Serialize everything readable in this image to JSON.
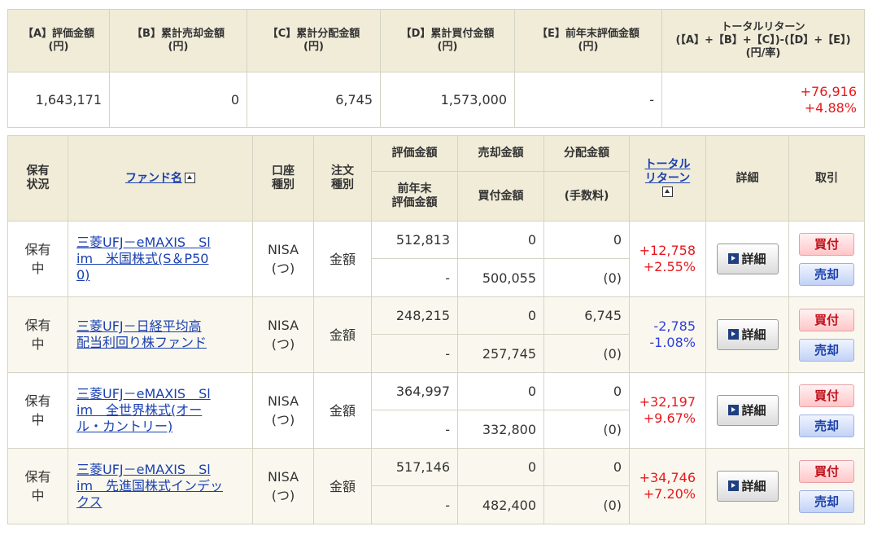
{
  "summary": {
    "headers": [
      [
        "【A】評価金額",
        "(円)"
      ],
      [
        "【B】累計売却金額",
        "(円)"
      ],
      [
        "【C】累計分配金額",
        "(円)"
      ],
      [
        "【D】累計買付金額",
        "(円)"
      ],
      [
        "【E】前年末評価金額",
        "(円)"
      ],
      [
        "トータルリターン",
        "(【A】+【B】+【C】)-(【D】+【E】)",
        "(円/率)"
      ]
    ],
    "values": [
      "1,643,171",
      "0",
      "6,745",
      "1,573,000",
      "-"
    ],
    "total_return_amount": "+76,916",
    "total_return_rate": "+4.88%"
  },
  "table_headers": {
    "status": [
      "保有",
      "状況"
    ],
    "fund_name": "ファンド名",
    "account": [
      "口座",
      "種別"
    ],
    "order": [
      "注文",
      "種別"
    ],
    "valuation": "評価金額",
    "prev_valuation": [
      "前年末",
      "評価金額"
    ],
    "sale": "売却金額",
    "purchase": "買付金額",
    "dividend": "分配金額",
    "fee": "(手数料)",
    "total_return": [
      "トータル",
      "リターン"
    ],
    "detail": "詳細",
    "trade": "取引"
  },
  "buttons": {
    "detail": "詳細",
    "buy": "買付",
    "sell": "売却"
  },
  "holdings": [
    {
      "status": [
        "保有",
        "中"
      ],
      "fund_lines": [
        "三菱UFJ－eMAXIS　Sl",
        "im　米国株式(S＆P50",
        "0)"
      ],
      "account": [
        "NISA",
        "(つ)"
      ],
      "order": "金額",
      "valuation": "512,813",
      "sale": "0",
      "dividend": "0",
      "prev_valuation": "-",
      "purchase": "500,055",
      "fee": "(0)",
      "return_amount": "+12,758",
      "return_rate": "+2.55%",
      "return_sign": "pos"
    },
    {
      "status": [
        "保有",
        "中"
      ],
      "fund_lines": [
        "三菱UFJ－日経平均高",
        "配当利回り株ファンド"
      ],
      "account": [
        "NISA",
        "(つ)"
      ],
      "order": "金額",
      "valuation": "248,215",
      "sale": "0",
      "dividend": "6,745",
      "prev_valuation": "-",
      "purchase": "257,745",
      "fee": "(0)",
      "return_amount": "-2,785",
      "return_rate": "-1.08%",
      "return_sign": "neg"
    },
    {
      "status": [
        "保有",
        "中"
      ],
      "fund_lines": [
        "三菱UFJ－eMAXIS　Sl",
        "im　全世界株式(オー",
        "ル・カントリー)"
      ],
      "account": [
        "NISA",
        "(つ)"
      ],
      "order": "金額",
      "valuation": "364,997",
      "sale": "0",
      "dividend": "0",
      "prev_valuation": "-",
      "purchase": "332,800",
      "fee": "(0)",
      "return_amount": "+32,197",
      "return_rate": "+9.67%",
      "return_sign": "pos"
    },
    {
      "status": [
        "保有",
        "中"
      ],
      "fund_lines": [
        "三菱UFJ－eMAXIS　Sl",
        "im　先進国株式インデッ",
        "クス"
      ],
      "account": [
        "NISA",
        "(つ)"
      ],
      "order": "金額",
      "valuation": "517,146",
      "sale": "0",
      "dividend": "0",
      "prev_valuation": "-",
      "purchase": "482,400",
      "fee": "(0)",
      "return_amount": "+34,746",
      "return_rate": "+7.20%",
      "return_sign": "pos"
    }
  ],
  "colors": {
    "header_bg": "#f0ecd8",
    "positive": "#e8181c",
    "negative": "#2e3fe0",
    "link": "#1a40b0"
  }
}
